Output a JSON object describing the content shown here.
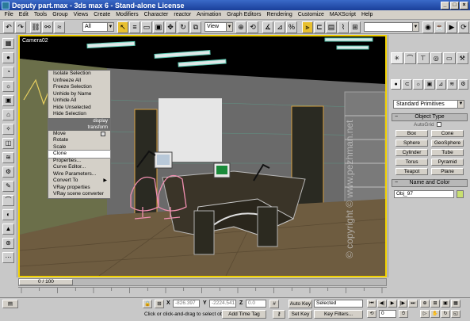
{
  "window": {
    "title": "Deputy part.max  -  3ds max 6  -  Stand-alone License",
    "min": "_",
    "max": "□",
    "close": "×"
  },
  "menubar": [
    "File",
    "Edit",
    "Tools",
    "Group",
    "Views",
    "Create",
    "Modifiers",
    "Character",
    "reactor",
    "Animation",
    "Graph Editors",
    "Rendering",
    "Customize",
    "MAXScript",
    "Help"
  ],
  "toolbar": {
    "selection_filter": "All",
    "reference_coord": "View"
  },
  "viewport": {
    "label": "Camera02",
    "watermark": "© copyright © www.pezhman.net"
  },
  "quad_menu": {
    "display_items": [
      "Isolate Selection",
      "Unfreeze All",
      "Freeze Selection",
      "Unhide by Name",
      "Unhide All",
      "Hide Unselected",
      "Hide Selection"
    ],
    "display_header": "display",
    "transform_header": "transform",
    "transform_items": [
      "Move",
      "Rotate",
      "Scale",
      "Clone",
      "Properties...",
      "Curve Editor...",
      "Wire Parameters...",
      "Convert To",
      "VRay properties",
      "VRay scene converter"
    ],
    "highlighted": "Clone"
  },
  "command_panel": {
    "primitive_type": "Standard Primitives",
    "object_type_title": "Object Type",
    "autogrid_label": "AutoGrid",
    "objects": [
      "Box",
      "Cone",
      "Sphere",
      "GeoSphere",
      "Cylinder",
      "Tube",
      "Torus",
      "Pyramid",
      "Teapot",
      "Plane"
    ],
    "name_color_title": "Name and Color",
    "object_name": "Obj_97",
    "object_color": "#c8e070"
  },
  "timeline": {
    "frame_display": "0 / 100",
    "ticks": [
      "0",
      "10",
      "20",
      "30",
      "40",
      "50",
      "60",
      "70",
      "80",
      "90",
      "100"
    ]
  },
  "status": {
    "x_value": "-826.397",
    "y_value": "-2224.541",
    "z_value": "0.0",
    "x_label": "X",
    "y_label": "Y",
    "z_label": "Z",
    "prompt": "Click or click-and-drag to select ob",
    "add_time_tag": "Add Time Tag",
    "auto_key": "Auto Key",
    "set_key": "Set Key",
    "key_mode": "Selected",
    "key_filters": "Key Filters...",
    "current_frame": "0"
  }
}
